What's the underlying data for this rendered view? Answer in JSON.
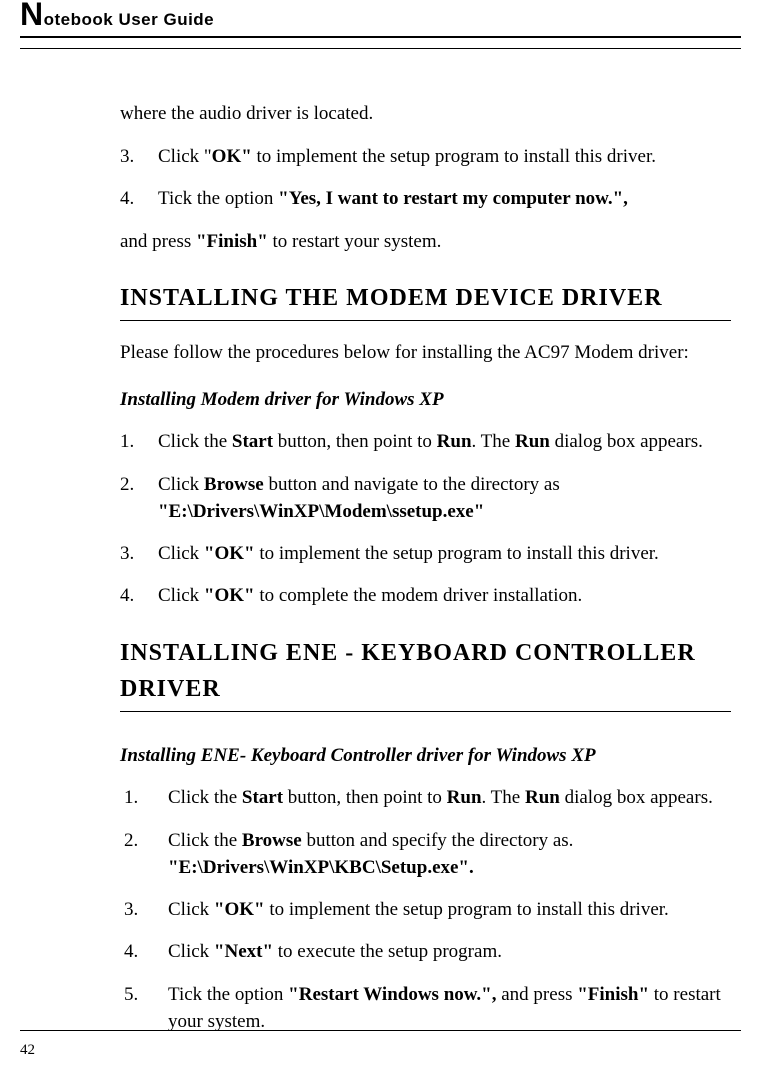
{
  "header": {
    "title_rest": "otebook User Guide",
    "big_letter": "N"
  },
  "page_number": "42",
  "intro_line": "where the audio driver is located.",
  "top_list": {
    "i3": {
      "num": "3.",
      "pre": "Click \"",
      "bold": "OK\"",
      "post": " to implement the setup program to install this driver."
    },
    "i4": {
      "num": "4.",
      "pre": "Tick the option ",
      "bold": "\"Yes, I want to restart my computer now.\","
    },
    "i4b": {
      "pre": "and press ",
      "bold": "\"Finish\"",
      "post": " to restart your system."
    }
  },
  "sec_modem": {
    "heading": "INSTALLING THE MODEM DEVICE DRIVER",
    "intro": "Please follow the procedures below for installing the AC97 Modem driver:",
    "sub": "Installing Modem driver for Windows XP",
    "i1": {
      "num": "1.",
      "t1": "Click the ",
      "b1": "Start",
      "t2": " button, then point to ",
      "b2": "Run",
      "t3": ". The ",
      "b3": "Run",
      "t4": " dialog box appears."
    },
    "i2": {
      "num": "2.",
      "t1": "Click ",
      "b1": "Browse",
      "t2": " button and navigate to the directory as",
      "path": "\"E:\\Drivers\\WinXP\\Modem\\ssetup.exe\""
    },
    "i3": {
      "num": "3.",
      "t1": "Click ",
      "b1": "\"OK\"",
      "t2": " to implement the setup program to install this driver."
    },
    "i4": {
      "num": "4.",
      "t1": "Click ",
      "b1": "\"OK\"",
      "t2": " to complete the modem driver installation."
    }
  },
  "sec_ene": {
    "heading": "INSTALLING ENE - KEYBOARD CONTROLLER DRIVER",
    "sub": "Installing ENE- Keyboard Controller driver for Windows XP",
    "i1": {
      "num": "1.",
      "t1": "Click the ",
      "b1": "Start",
      "t2": " button, then point to ",
      "b2": "Run",
      "t3": ". The ",
      "b3": "Run",
      "t4": " dialog box appears."
    },
    "i2": {
      "num": "2.",
      "t1": "Click the ",
      "b1": "Browse",
      "t2": " button and specify the directory as.",
      "path": "\"E:\\Drivers\\WinXP\\KBC\\Setup.exe\"."
    },
    "i3": {
      "num": "3.",
      "t1": "Click ",
      "b1": "\"OK\"",
      "t2": " to implement the setup program to install this driver."
    },
    "i4": {
      "num": "4.",
      "t1": "Click ",
      "b1": "\"Next\"",
      "t2": " to execute the setup program."
    },
    "i5": {
      "num": "5.",
      "t1": "Tick the option ",
      "b1": "\"Restart Windows now.\", ",
      "t2": " and press ",
      "b2": "\"Finish\"",
      "t3": " to restart your system."
    }
  }
}
